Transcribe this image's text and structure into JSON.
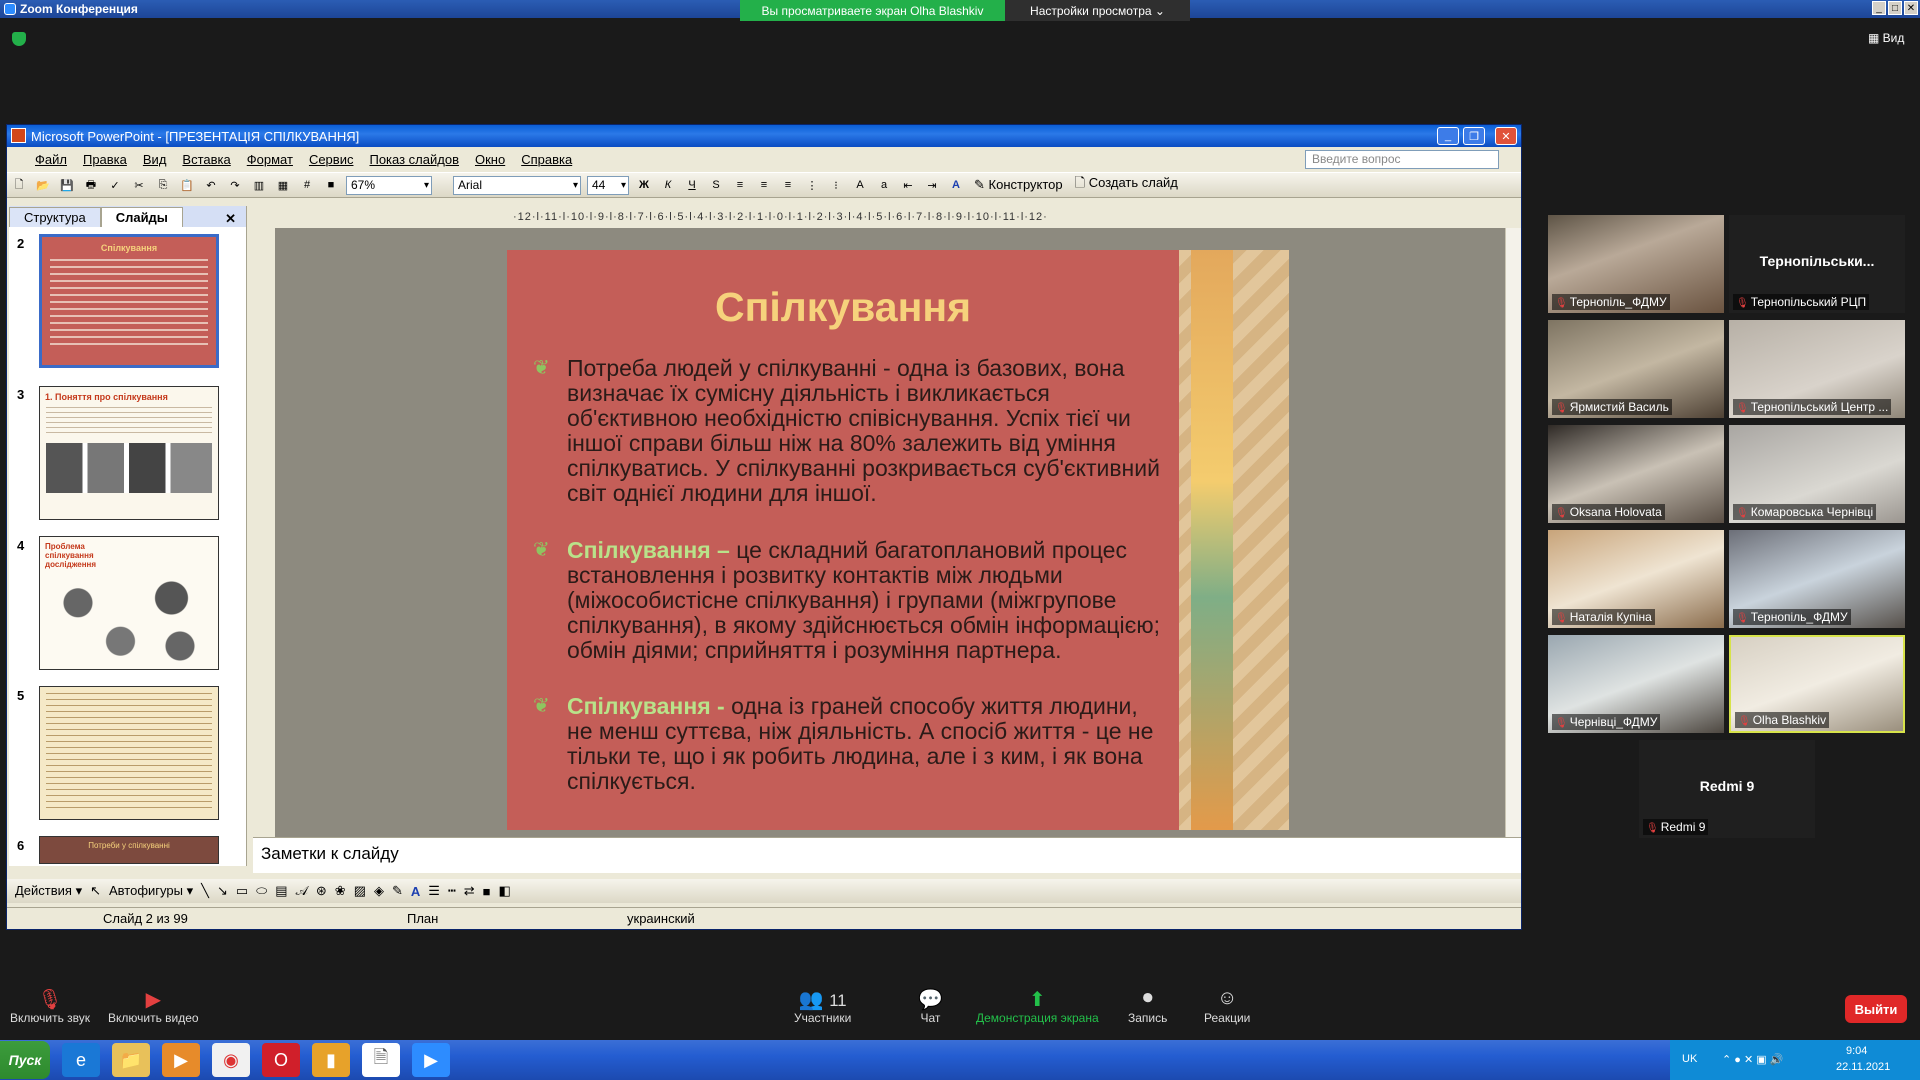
{
  "zoom": {
    "window_title": "Zoom Конференция",
    "share_banner": "Вы просматриваете экран Olha Blashkiv",
    "view_settings": "Настройки просмотра",
    "view_label": "Вид"
  },
  "ppt": {
    "title": "Microsoft PowerPoint - [ПРЕЗЕНТАЦІЯ СПІЛКУВАННЯ]",
    "menu": [
      "Файл",
      "Правка",
      "Вид",
      "Вставка",
      "Формат",
      "Сервис",
      "Показ слайдов",
      "Окно",
      "Справка"
    ],
    "ask_placeholder": "Введите вопрос",
    "zoom_level": "67%",
    "font_name": "Arial",
    "font_size": "44",
    "designer": "Конструктор",
    "new_slide": "Создать слайд",
    "tab_outline": "Структура",
    "tab_slides": "Слайды",
    "ruler": "·12·l·11·l·10·l·9·l·8·l·7·l·6·l·5·l·4·l·3·l·2·l·1·l·0·l·1·l·2·l·3·l·4·l·5·l·6·l·7·l·8·l·9·l·10·l·11·l·12·",
    "thumb_numbers": [
      "2",
      "3",
      "4",
      "5",
      "6"
    ],
    "thumb_titles": [
      "Спілкування",
      "1. Поняття про спілкування",
      "Проблема спілкування дослідження",
      "",
      "Потреби у спілкуванні"
    ],
    "notes": "Заметки к слайду",
    "actions": "Действия",
    "autoshapes": "Автофигуры",
    "status_slide": "Слайд 2 из 99",
    "status_design": "План",
    "status_lang": "украинский"
  },
  "slide": {
    "title": "Спілкування",
    "bullet1": "Потреба людей у спілкуванні - одна із базових, вона визначає їх сумісну діяльність і викликається об'єктивною необхідністю співіснування. Успіх тієї чи іншої справи більш ніж на 80% залежить від уміння спілкуватись. У спілкуванні розкривається суб'єктивний світ однієї людини для іншої.",
    "bullet2_hl": "Спілкування –",
    "bullet2": " це складний багатоплановий процес встановлення і розвитку контактів між людьми (міжособистісне спілкування) і групами (міжгрупове спілкування), в якому здійснюється обмін інформацією; обмін діями; сприйняття і розуміння партнера.",
    "bullet3_hl": "Спілкування -",
    "bullet3": " одна із граней способу життя людини, не менш суттєва, ніж діяльність. А спосіб життя - це не тільки те, що і як робить людина, але і з ким, і як вона спілкується."
  },
  "participants": [
    {
      "name": "Тернопіль_ФДМУ"
    },
    {
      "name": "Тернопільський РЦП",
      "big": "Тернопільськи..."
    },
    {
      "name": "Ярмистий Василь"
    },
    {
      "name": "Тернопільський Центр ..."
    },
    {
      "name": "Oksana Holovata"
    },
    {
      "name": "Комаровська Чернівці"
    },
    {
      "name": "Наталія Купіна"
    },
    {
      "name": "Тернопіль_ФДМУ"
    },
    {
      "name": "Чернівці_ФДМУ"
    },
    {
      "name": "Olha Blashkiv"
    },
    {
      "name": "Redmi 9",
      "big": "Redmi 9"
    }
  ],
  "controls": {
    "unmute": "Включить звук",
    "start_video": "Включить видео",
    "participants": "Участники",
    "participants_count": "11",
    "chat": "Чат",
    "share": "Демонстрация экрана",
    "record": "Запись",
    "reactions": "Реакции",
    "leave": "Выйти"
  },
  "taskbar": {
    "start": "Пуск",
    "lang": "UK",
    "time": "9:04",
    "date": "22.11.2021"
  }
}
